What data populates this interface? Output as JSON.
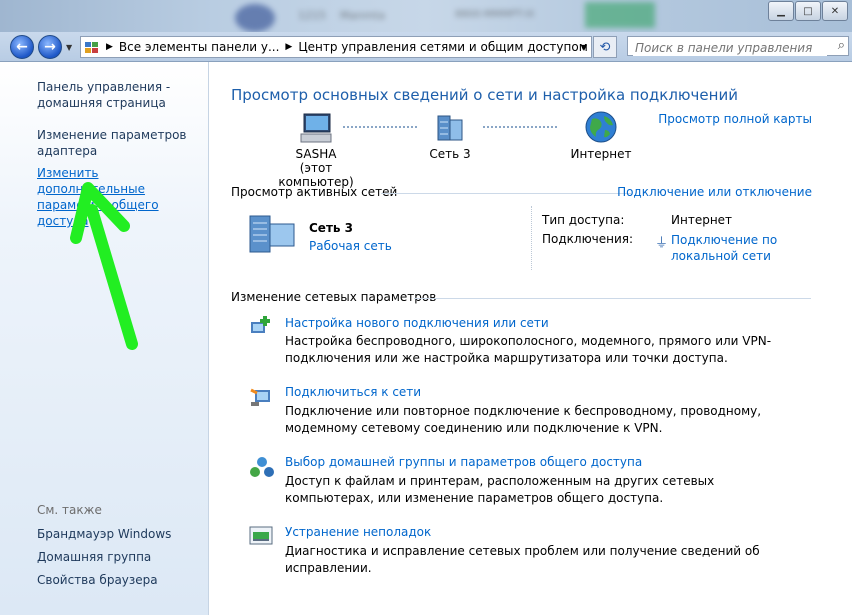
{
  "titlebar": {
    "blurred_texts": [
      "1215",
      "Manmta",
      "8800-MMMPT-IX"
    ],
    "controls": [
      "minimize",
      "maximize",
      "close"
    ]
  },
  "address": {
    "breadcrumbs": [
      "Все элементы панели у...",
      "Центр управления сетями и общим доступом"
    ],
    "search_placeholder": "Поиск в панели управления"
  },
  "sidebar": {
    "home": "Панель управления - домашняя страница",
    "adapter": "Изменение параметров адаптера",
    "sharing": "Изменить дополнительные параметры общего доступа",
    "see_also": "См. также",
    "links": [
      "Брандмауэр Windows",
      "Домашняя группа",
      "Свойства браузера"
    ]
  },
  "main": {
    "heading": "Просмотр основных сведений о сети и настройка подключений",
    "full_map": "Просмотр полной карты",
    "nodes": [
      {
        "label": "SASHA",
        "sub": "(этот компьютер)",
        "icon": "computer-icon"
      },
      {
        "label": "Сеть  3",
        "sub": "",
        "icon": "network-icon"
      },
      {
        "label": "Интернет",
        "sub": "",
        "icon": "globe-icon"
      }
    ],
    "active_networks_label": "Просмотр активных сетей",
    "connect_disconnect": "Подключение или отключение",
    "network": {
      "name": "Сеть  3",
      "type": "Рабочая сеть",
      "access_label": "Тип доступа:",
      "access_value": "Интернет",
      "connections_label": "Подключения:",
      "connections_value": "Подключение по локальной сети"
    },
    "change_settings_label": "Изменение сетевых параметров",
    "tasks": [
      {
        "title": "Настройка нового подключения или сети",
        "desc": "Настройка беспроводного, широкополосного, модемного, прямого или VPN-подключения или же настройка маршрутизатора или точки доступа.",
        "icon": "new-connection-icon"
      },
      {
        "title": "Подключиться к сети",
        "desc": "Подключение или повторное подключение к беспроводному, проводному, модемному сетевому соединению или подключение к VPN.",
        "icon": "connect-network-icon"
      },
      {
        "title": "Выбор домашней группы и параметров общего доступа",
        "desc": "Доступ к файлам и принтерам, расположенным на других сетевых компьютерах, или изменение параметров общего доступа.",
        "icon": "homegroup-icon"
      },
      {
        "title": "Устранение неполадок",
        "desc": "Диагностика и исправление сетевых проблем или получение сведений об исправлении.",
        "icon": "troubleshoot-icon"
      }
    ]
  },
  "annotation": {
    "arrow_color": "#22ee22"
  }
}
